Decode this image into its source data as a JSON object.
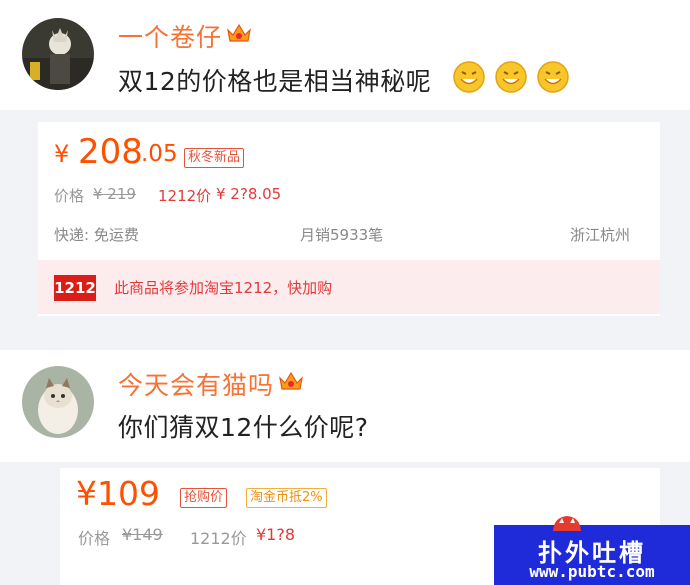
{
  "post1": {
    "username": "一个卷仔",
    "comment": "双12的价格也是相当神秘呢",
    "emoji_icons": [
      "grin-emoji-icon",
      "grin-emoji-icon",
      "grin-emoji-icon"
    ]
  },
  "card1": {
    "currency": "¥",
    "price_int": "208",
    "price_dec": ".05",
    "tag": "秋冬新品",
    "orig_label": "价格",
    "orig_price": "¥ 219",
    "promo_label": "1212价",
    "promo_price": "¥ 2?8.05",
    "shipping": "快递: 免运费",
    "sales": "月销5933笔",
    "location": "浙江杭州",
    "banner_logo": "1212",
    "banner_text": "此商品将参加淘宝1212，快加购"
  },
  "post2": {
    "username": "今天会有猫吗",
    "comment": "你们猜双12什么价呢?"
  },
  "card2": {
    "price": "¥109",
    "tag1": "抢购价",
    "tag2": "淘金币抵2%",
    "orig_label": "价格",
    "orig_price": "¥149",
    "promo_label": "1212价",
    "promo_price": "¥1?8"
  },
  "watermark": {
    "title": "扑外吐槽",
    "url": "www.pubtc.com"
  },
  "colors": {
    "username": "#f77234",
    "price": "#ff5000",
    "promo": "#e23a3a",
    "banner_bg": "#fdeced",
    "watermark_bg": "#1f2bd8"
  }
}
